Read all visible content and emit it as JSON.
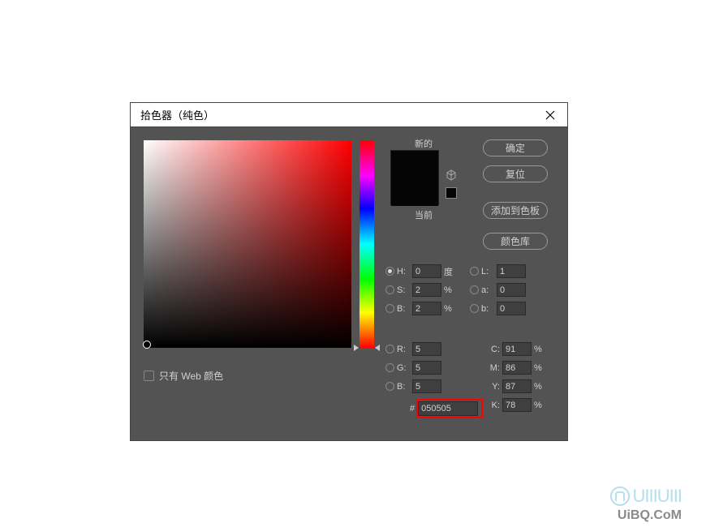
{
  "dialog": {
    "title": "拾色器（纯色）",
    "new_label": "新的",
    "current_label": "当前"
  },
  "buttons": {
    "ok": "确定",
    "cancel": "复位",
    "add_swatch": "添加到色板",
    "color_lib": "颜色库"
  },
  "hsb": {
    "h_label": "H:",
    "s_label": "S:",
    "b_label": "B:",
    "h_value": "0",
    "s_value": "2",
    "b_value": "2",
    "h_unit": "度",
    "s_unit": "%",
    "b_unit": "%"
  },
  "lab": {
    "l_label": "L:",
    "a_label": "a:",
    "b_label": "b:",
    "l_value": "1",
    "a_value": "0",
    "b_value": "0"
  },
  "rgb": {
    "r_label": "R:",
    "g_label": "G:",
    "b_label": "B:",
    "r_value": "5",
    "g_value": "5",
    "b_value": "5"
  },
  "cmyk": {
    "c_label": "C:",
    "m_label": "M:",
    "y_label": "Y:",
    "k_label": "K:",
    "c_value": "91",
    "m_value": "86",
    "y_value": "87",
    "k_value": "78",
    "unit": "%"
  },
  "hex": {
    "label": "#",
    "value": "050505"
  },
  "web_only": {
    "label": "只有 Web 颜色"
  },
  "watermark": {
    "logo": "UIIIUIII",
    "site": "UiBQ.CoM"
  },
  "colors": {
    "selected": "#050505",
    "new": "#050505",
    "current": "#050505"
  }
}
